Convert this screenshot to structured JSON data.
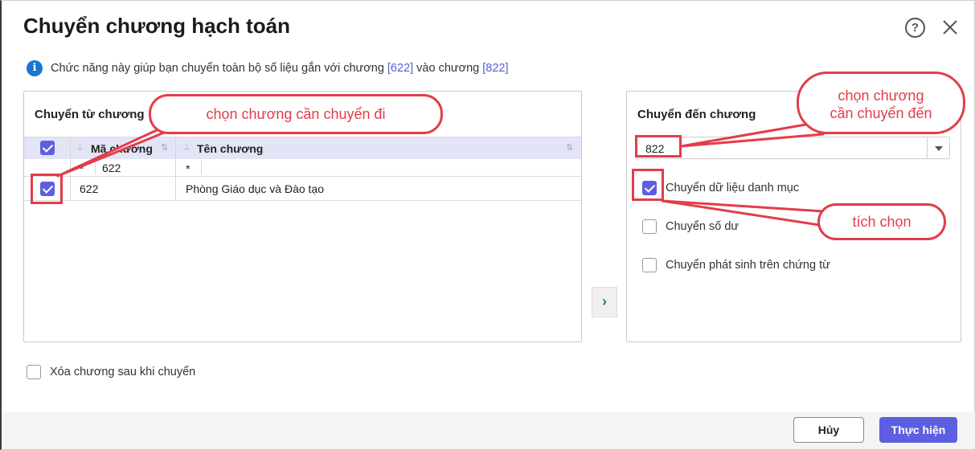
{
  "dialog": {
    "title": "Chuyển chương hạch toán",
    "info": {
      "prefix": "Chức năng này giúp bạn chuyển toàn bộ số liệu gắn với chương",
      "from_code": "[622]",
      "middle": "vào chương",
      "to_code": "[822]"
    }
  },
  "source_panel": {
    "title": "Chuyển từ chương",
    "columns": [
      "Mã chương",
      "Tên chương"
    ],
    "filter": {
      "code_op": "*",
      "code_value": "622",
      "name_op": "*"
    },
    "rows": [
      {
        "checked": true,
        "code": "622",
        "name": "Phòng Giáo dục và Đào tạo"
      }
    ],
    "select_all_checked": true
  },
  "target_panel": {
    "title": "Chuyển đến chương",
    "selected_value": "822",
    "options": [
      {
        "label": "Chuyển dữ liệu danh mục",
        "checked": true
      },
      {
        "label": "Chuyển số dư",
        "checked": false
      },
      {
        "label": "Chuyển phát sinh trên chứng từ",
        "checked": false
      }
    ]
  },
  "move_button": "›",
  "delete_after": {
    "label": "Xóa chương sau khi chuyển",
    "checked": false
  },
  "footer": {
    "cancel_label": "Hủy",
    "ok_label": "Thực hiện"
  },
  "annotations": {
    "callout_source": "chọn chương cần chuyển đi",
    "callout_target_line1": "chọn chương",
    "callout_target_line2": "cần chuyển đến",
    "callout_check": "tích chọn"
  },
  "colors": {
    "accent": "#5d5fe0",
    "annotation": "#e23d4a",
    "info": "#1976d2"
  }
}
